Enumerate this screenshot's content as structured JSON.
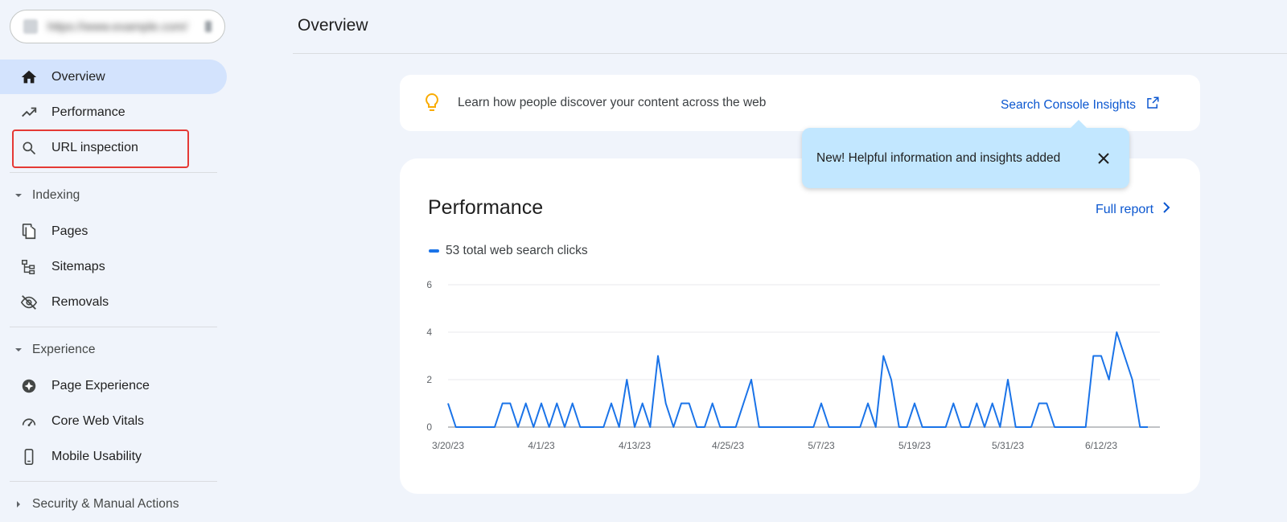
{
  "sidebar": {
    "property_url": "https://www.example.com/",
    "items": [
      {
        "key": "overview",
        "label": "Overview"
      },
      {
        "key": "performance",
        "label": "Performance"
      },
      {
        "key": "url-inspection",
        "label": "URL inspection"
      }
    ],
    "sections": [
      {
        "label": "Indexing",
        "items": [
          "Pages",
          "Sitemaps",
          "Removals"
        ]
      },
      {
        "label": "Experience",
        "items": [
          "Page Experience",
          "Core Web Vitals",
          "Mobile Usability"
        ]
      },
      {
        "label": "Security & Manual Actions",
        "items": []
      }
    ]
  },
  "header": {
    "title": "Overview"
  },
  "insights": {
    "text": "Learn how people discover your content across the web",
    "link_label": "Search Console Insights"
  },
  "tooltip": {
    "text": "New! Helpful information and insights added"
  },
  "performance": {
    "title": "Performance",
    "full_report": "Full report",
    "legend": "53 total web search clicks"
  },
  "colors": {
    "accent": "#0b57d0",
    "line": "#1a73e8",
    "active_nav": "#d3e3fd",
    "tooltip": "#c2e7ff",
    "bulb": "#f9ab00"
  },
  "chart_data": {
    "type": "line",
    "series": [
      {
        "name": "53 total web search clicks",
        "values": [
          1,
          0,
          0,
          0,
          0,
          0,
          0,
          1,
          1,
          0,
          1,
          0,
          1,
          0,
          1,
          0,
          1,
          0,
          0,
          0,
          0,
          1,
          0,
          2,
          0,
          1,
          0,
          3,
          1,
          0,
          1,
          1,
          0,
          0,
          1,
          0,
          0,
          0,
          1,
          2,
          0,
          0,
          0,
          0,
          0,
          0,
          0,
          0,
          1,
          0,
          0,
          0,
          0,
          0,
          1,
          0,
          3,
          2,
          0,
          0,
          1,
          0,
          0,
          0,
          0,
          1,
          0,
          0,
          1,
          0,
          1,
          0,
          2,
          0,
          0,
          0,
          1,
          1,
          0,
          0,
          0,
          0,
          0,
          3,
          3,
          2,
          4,
          3,
          2,
          0,
          0
        ]
      }
    ],
    "x_start": "3/20/23",
    "x_ticks": [
      "3/20/23",
      "4/1/23",
      "4/13/23",
      "4/25/23",
      "5/7/23",
      "5/19/23",
      "5/31/23",
      "6/12/23"
    ],
    "y_ticks": [
      0,
      2,
      4,
      6
    ],
    "ylim": [
      0,
      6
    ],
    "grid": true
  }
}
